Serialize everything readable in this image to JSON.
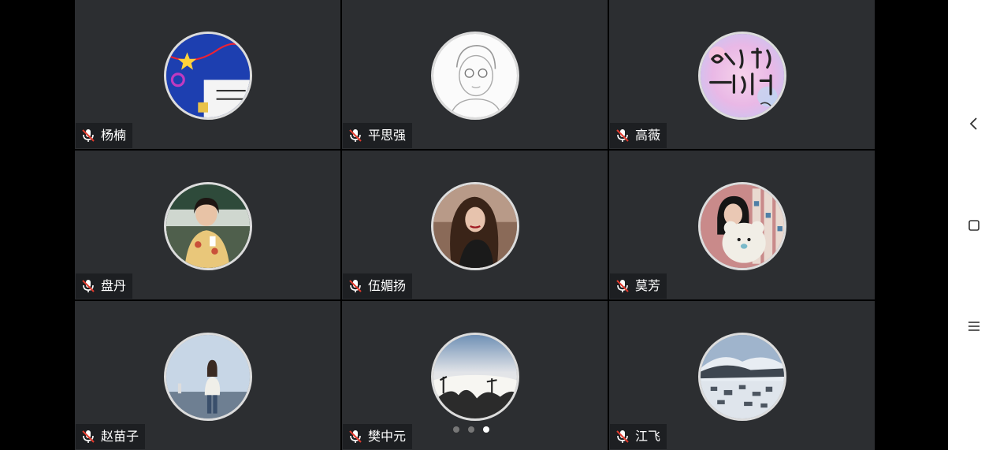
{
  "participants": [
    {
      "name": "杨楠",
      "avatar": "cartoon-blue-poster",
      "muted": true
    },
    {
      "name": "平思强",
      "avatar": "pencil-sketch-boy",
      "muted": true
    },
    {
      "name": "高薇",
      "avatar": "calligraphy-pink",
      "muted": true
    },
    {
      "name": "盘丹",
      "avatar": "girl-yellow-shirt",
      "muted": true
    },
    {
      "name": "伍媚扬",
      "avatar": "curly-hair-woman",
      "muted": true
    },
    {
      "name": "莫芳",
      "avatar": "girl-with-bear",
      "muted": true
    },
    {
      "name": "赵苗子",
      "avatar": "woman-by-sea",
      "muted": true
    },
    {
      "name": "樊中元",
      "avatar": "sea-of-clouds",
      "muted": true
    },
    {
      "name": "江飞",
      "avatar": "snowy-village",
      "muted": true
    }
  ],
  "pager": {
    "pages": 3,
    "current": 3
  },
  "navbar": {
    "icons": [
      "back-icon",
      "home-icon",
      "menu-icon"
    ]
  },
  "colors": {
    "tile": "#2c2e31",
    "badge": "#1d1f22",
    "mic_muted": "#e23b2e"
  }
}
